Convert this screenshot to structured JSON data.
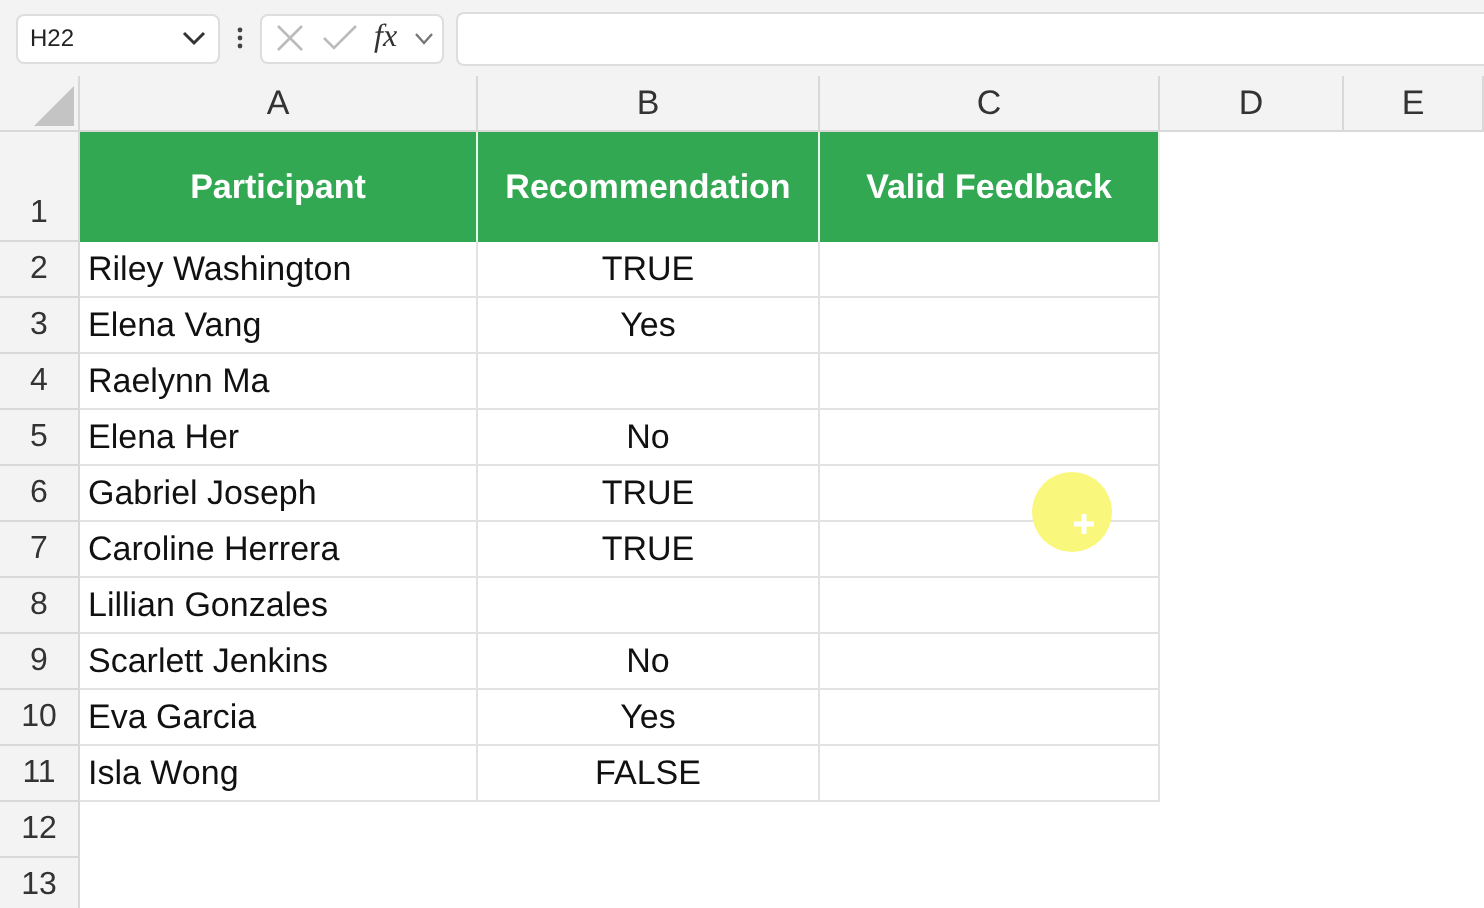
{
  "name_box": {
    "value": "H22"
  },
  "formula_bar": {
    "function_label": "fx"
  },
  "columns": [
    "A",
    "B",
    "C",
    "D",
    "E"
  ],
  "header_row": {
    "number": "1",
    "cells": [
      "Participant",
      "Recommendation",
      "Valid Feedback"
    ]
  },
  "rows": [
    {
      "number": "2",
      "participant": "Riley Washington",
      "recommendation": "TRUE"
    },
    {
      "number": "3",
      "participant": "Elena Vang",
      "recommendation": "Yes"
    },
    {
      "number": "4",
      "participant": "Raelynn Ma"
    },
    {
      "number": "5",
      "participant": "Elena Her",
      "recommendation": "No"
    },
    {
      "number": "6",
      "participant": "Gabriel Joseph",
      "recommendation": "TRUE"
    },
    {
      "number": "7",
      "participant": "Caroline Herrera",
      "recommendation": "TRUE"
    },
    {
      "number": "8",
      "participant": "Lillian Gonzales"
    },
    {
      "number": "9",
      "participant": "Scarlett Jenkins",
      "recommendation": "No"
    },
    {
      "number": "10",
      "participant": "Eva Garcia",
      "recommendation": "Yes"
    },
    {
      "number": "11",
      "participant": "Isla Wong",
      "recommendation": "FALSE"
    },
    {
      "number": "12"
    },
    {
      "number": "13"
    }
  ]
}
